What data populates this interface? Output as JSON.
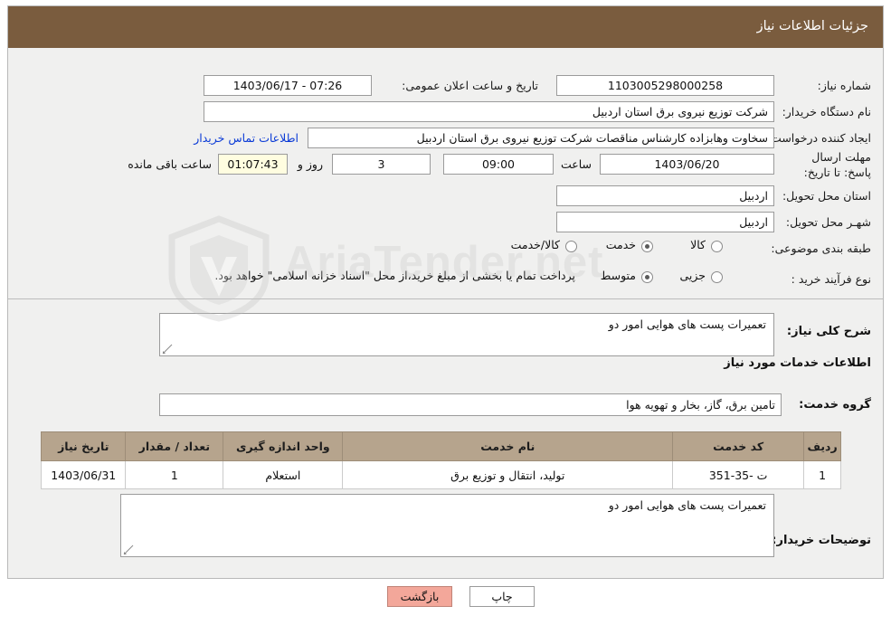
{
  "header": {
    "title": "جزئیات اطلاعات نیاز"
  },
  "watermark": {
    "text": "AriaTender.net",
    "icon": "shield-icon"
  },
  "form": {
    "need_number": {
      "label": "شماره نیاز:",
      "value": "1103005298000258"
    },
    "announce_datetime": {
      "label": "تاریخ و ساعت اعلان عمومی:",
      "value": "1403/06/17 - 07:26"
    },
    "buyer_org": {
      "label": "نام دستگاه خریدار:",
      "value": "شرکت توزیع نیروی برق استان اردبیل"
    },
    "requester": {
      "label": "ایجاد کننده درخواست:",
      "value": "سخاوت وهابزاده کارشناس مناقصات شرکت توزیع نیروی برق استان اردبیل"
    },
    "contact_link": {
      "label": "اطلاعات تماس خریدار"
    },
    "deadline": {
      "label": "مهلت ارسال پاسخ: تا تاریخ:",
      "date": "1403/06/20",
      "time_label": "ساعت",
      "time": "09:00",
      "days": "3",
      "days_label": "روز و",
      "remaining": "01:07:43",
      "remaining_label": "ساعت باقی مانده"
    },
    "delivery_province": {
      "label": "استان محل تحویل:",
      "value": "اردبیل"
    },
    "delivery_city": {
      "label": "شهـر محل تحویل:",
      "value": "اردبیل"
    },
    "category": {
      "label": "طبقه بندی موضوعی:",
      "options": [
        {
          "label": "کالا",
          "selected": false
        },
        {
          "label": "خدمت",
          "selected": true
        },
        {
          "label": "کالا/خدمت",
          "selected": false
        }
      ]
    },
    "purchase_type": {
      "label": "نوع فرآیند خرید :",
      "options": [
        {
          "label": "جزیی",
          "selected": false
        },
        {
          "label": "متوسط",
          "selected": true
        }
      ],
      "note": "پرداخت تمام یا بخشی از مبلغ خرید،از محل \"اسناد خزانه اسلامی\" خواهد بود."
    }
  },
  "details": {
    "need_description_label": "شرح کلی نیاز:",
    "need_description_value": "تعمیرات پست های هوایی امور دو",
    "services_info_title": "اطلاعات خدمات مورد نیاز",
    "service_group_label": "گروه خدمت:",
    "service_group_value": "تامین برق، گاز، بخار و تهویه هوا",
    "table": {
      "columns": [
        "ردیف",
        "کد خدمت",
        "نام خدمت",
        "واحد اندازه گیری",
        "تعداد / مقدار",
        "تاریخ نیاز"
      ],
      "rows": [
        [
          "1",
          "ت -35-351",
          "تولید، انتقال و توزیع برق",
          "استعلام",
          "1",
          "1403/06/31"
        ]
      ]
    },
    "buyer_notes_label": "توضیحات خریدار:",
    "buyer_notes_value": "تعمیرات پست های هوایی امور دو"
  },
  "footer": {
    "print_button": "چاپ",
    "back_button": "بازگشت"
  }
}
